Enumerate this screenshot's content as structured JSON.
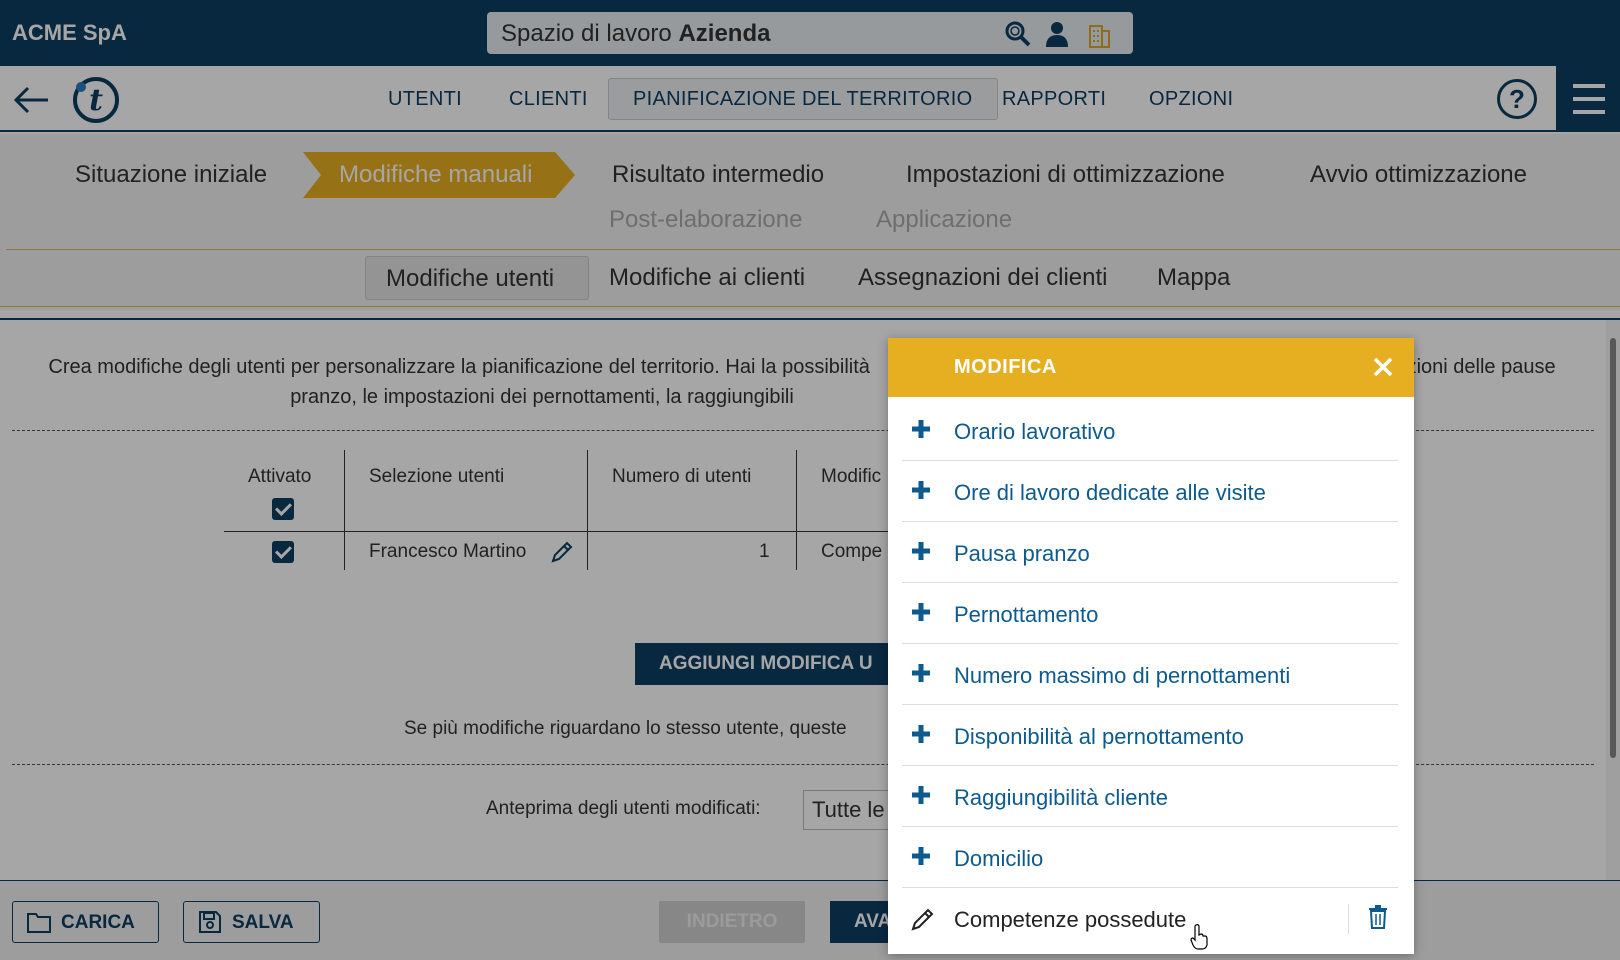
{
  "header": {
    "company": "ACME SpA",
    "workspace_prefix": "Spazio di lavoro",
    "workspace_name": "Azienda",
    "icons": [
      "search-icon",
      "user-icon",
      "building-icon"
    ]
  },
  "nav": {
    "items": [
      {
        "label": "UTENTI"
      },
      {
        "label": "CLIENTI"
      },
      {
        "label": "PIANIFICAZIONE DEL TERRITORIO",
        "active": true
      },
      {
        "label": "RAPPORTI"
      },
      {
        "label": "OPZIONI"
      }
    ],
    "help": "?"
  },
  "steps": {
    "items": [
      "Situazione iniziale",
      "Modifiche manuali",
      "Risultato intermedio",
      "Impostazioni di ottimizzazione",
      "Avvio ottimizzazione"
    ],
    "disabled": [
      "Post-elaborazione",
      "Applicazione"
    ],
    "active_color": "#e6ae21"
  },
  "subtabs": [
    "Modifiche utenti",
    "Modifiche ai clienti",
    "Assegnazioni dei clienti",
    "Mappa"
  ],
  "content": {
    "description_line1": "Crea modifiche degli utenti per personalizzare la pianificazione del territorio. Hai la possibilità",
    "description_line1_end": "tazioni delle pause",
    "description_line2": "pranzo, le impostazioni dei pernottamenti, la raggiungibili",
    "table": {
      "headers": [
        "Attivato",
        "Selezione utenti",
        "Numero di utenti",
        "Modific"
      ],
      "rows": [
        {
          "activated": true,
          "users": "Francesco Martino",
          "count": "1",
          "modification": "Compe"
        }
      ]
    },
    "add_button": "AGGIUNGI MODIFICA U",
    "note": "Se più modifiche riguardano lo stesso utente, queste",
    "preview_label": "Anteprima degli utenti modificati:",
    "preview_value": "Tutte le"
  },
  "footer": {
    "load": "CARICA",
    "save": "SALVA",
    "back": "INDIETRO",
    "next": "AVA"
  },
  "modal": {
    "title": "MODIFICA",
    "options": [
      "Orario lavorativo",
      "Ore di lavoro dedicate alle visite",
      "Pausa pranzo",
      "Pernottamento",
      "Numero massimo di pernottamenti",
      "Disponibilità al pernottamento",
      "Raggiungibilità cliente",
      "Domicilio"
    ],
    "edit_item": "Competenze possedute"
  }
}
